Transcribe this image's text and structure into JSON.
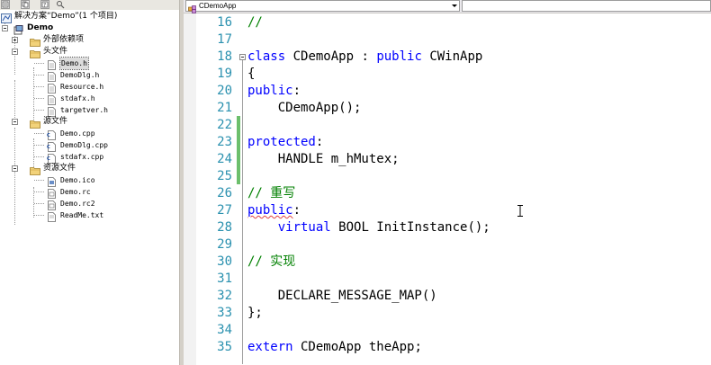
{
  "solution_explorer": {
    "toolbar_icons": [
      "properties-icon",
      "show-all-files-icon",
      "refresh-icon",
      "view-class-diagram-icon"
    ],
    "solution_label": "解决方案“Demo”(1 个项目)",
    "project_label": "Demo",
    "items": [
      {
        "label": "外部依赖项",
        "icon": "folder-icon",
        "kind": "folder",
        "expander": "plus",
        "mono": false
      },
      {
        "label": "头文件",
        "icon": "folder-open-icon",
        "kind": "folder",
        "expander": "minus",
        "mono": false
      },
      {
        "label": "Demo.h",
        "icon": "header-file-icon",
        "kind": "file",
        "selected": true,
        "mono": true
      },
      {
        "label": "DemoDlg.h",
        "icon": "header-file-icon",
        "kind": "file",
        "mono": true
      },
      {
        "label": "Resource.h",
        "icon": "header-file-icon",
        "kind": "file",
        "mono": true
      },
      {
        "label": "stdafx.h",
        "icon": "header-file-icon",
        "kind": "file",
        "mono": true
      },
      {
        "label": "targetver.h",
        "icon": "header-file-icon",
        "kind": "file",
        "mono": true
      },
      {
        "label": "源文件",
        "icon": "folder-open-icon",
        "kind": "folder",
        "expander": "minus",
        "mono": false
      },
      {
        "label": "Demo.cpp",
        "icon": "cpp-file-icon",
        "kind": "file",
        "mono": true
      },
      {
        "label": "DemoDlg.cpp",
        "icon": "cpp-file-icon",
        "kind": "file",
        "mono": true
      },
      {
        "label": "stdafx.cpp",
        "icon": "cpp-file-icon",
        "kind": "file",
        "mono": true
      },
      {
        "label": "资源文件",
        "icon": "folder-open-icon",
        "kind": "folder",
        "expander": "minus",
        "mono": false
      },
      {
        "label": "Demo.ico",
        "icon": "icon-file-icon",
        "kind": "file",
        "mono": true
      },
      {
        "label": "Demo.rc",
        "icon": "resource-file-icon",
        "kind": "file",
        "mono": true
      },
      {
        "label": "Demo.rc2",
        "icon": "resource-file-icon",
        "kind": "file",
        "mono": true
      },
      {
        "label": "ReadMe.txt",
        "icon": "text-file-icon",
        "kind": "file",
        "mono": true
      }
    ]
  },
  "editor": {
    "class_dropdown_value": "CDemoApp",
    "member_dropdown_value": "",
    "lines": [
      {
        "n": "16",
        "tokens": [
          {
            "t": "//",
            "c": "cm"
          }
        ]
      },
      {
        "n": "17",
        "tokens": []
      },
      {
        "n": "18",
        "tokens": [
          {
            "t": "class",
            "c": "kw"
          },
          {
            "t": " CDemoApp : ",
            "c": ""
          },
          {
            "t": "public",
            "c": "kw"
          },
          {
            "t": " CWinApp",
            "c": ""
          }
        ]
      },
      {
        "n": "19",
        "tokens": [
          {
            "t": "{",
            "c": ""
          }
        ]
      },
      {
        "n": "20",
        "tokens": [
          {
            "t": "public",
            "c": "kw"
          },
          {
            "t": ":",
            "c": ""
          }
        ]
      },
      {
        "n": "21",
        "tokens": [
          {
            "t": "    CDemoApp();",
            "c": ""
          }
        ]
      },
      {
        "n": "22",
        "tokens": []
      },
      {
        "n": "23",
        "tokens": [
          {
            "t": "protected",
            "c": "kw"
          },
          {
            "t": ":",
            "c": ""
          }
        ]
      },
      {
        "n": "24",
        "tokens": [
          {
            "t": "    HANDLE m_hMutex;",
            "c": ""
          }
        ]
      },
      {
        "n": "25",
        "tokens": []
      },
      {
        "n": "26",
        "tokens": [
          {
            "t": "// 重写",
            "c": "cm"
          }
        ]
      },
      {
        "n": "27",
        "tokens": [
          {
            "t": "public",
            "c": "kw squig"
          },
          {
            "t": ":",
            "c": ""
          }
        ]
      },
      {
        "n": "28",
        "tokens": [
          {
            "t": "    ",
            "c": ""
          },
          {
            "t": "virtual",
            "c": "kw"
          },
          {
            "t": " BOOL InitInstance();",
            "c": ""
          }
        ]
      },
      {
        "n": "29",
        "tokens": []
      },
      {
        "n": "30",
        "tokens": [
          {
            "t": "// 实现",
            "c": "cm"
          }
        ]
      },
      {
        "n": "31",
        "tokens": []
      },
      {
        "n": "32",
        "tokens": [
          {
            "t": "    DECLARE_MESSAGE_MAP()",
            "c": ""
          }
        ]
      },
      {
        "n": "33",
        "tokens": [
          {
            "t": "};",
            "c": ""
          }
        ]
      },
      {
        "n": "34",
        "tokens": []
      },
      {
        "n": "35",
        "tokens": [
          {
            "t": "extern",
            "c": "kw"
          },
          {
            "t": " CDemoApp theApp;",
            "c": ""
          }
        ]
      }
    ]
  },
  "colors": {
    "keyword": "#0000ff",
    "comment": "#008000",
    "line_number": "#2b91af",
    "change_bar": "#6cbf6c"
  }
}
